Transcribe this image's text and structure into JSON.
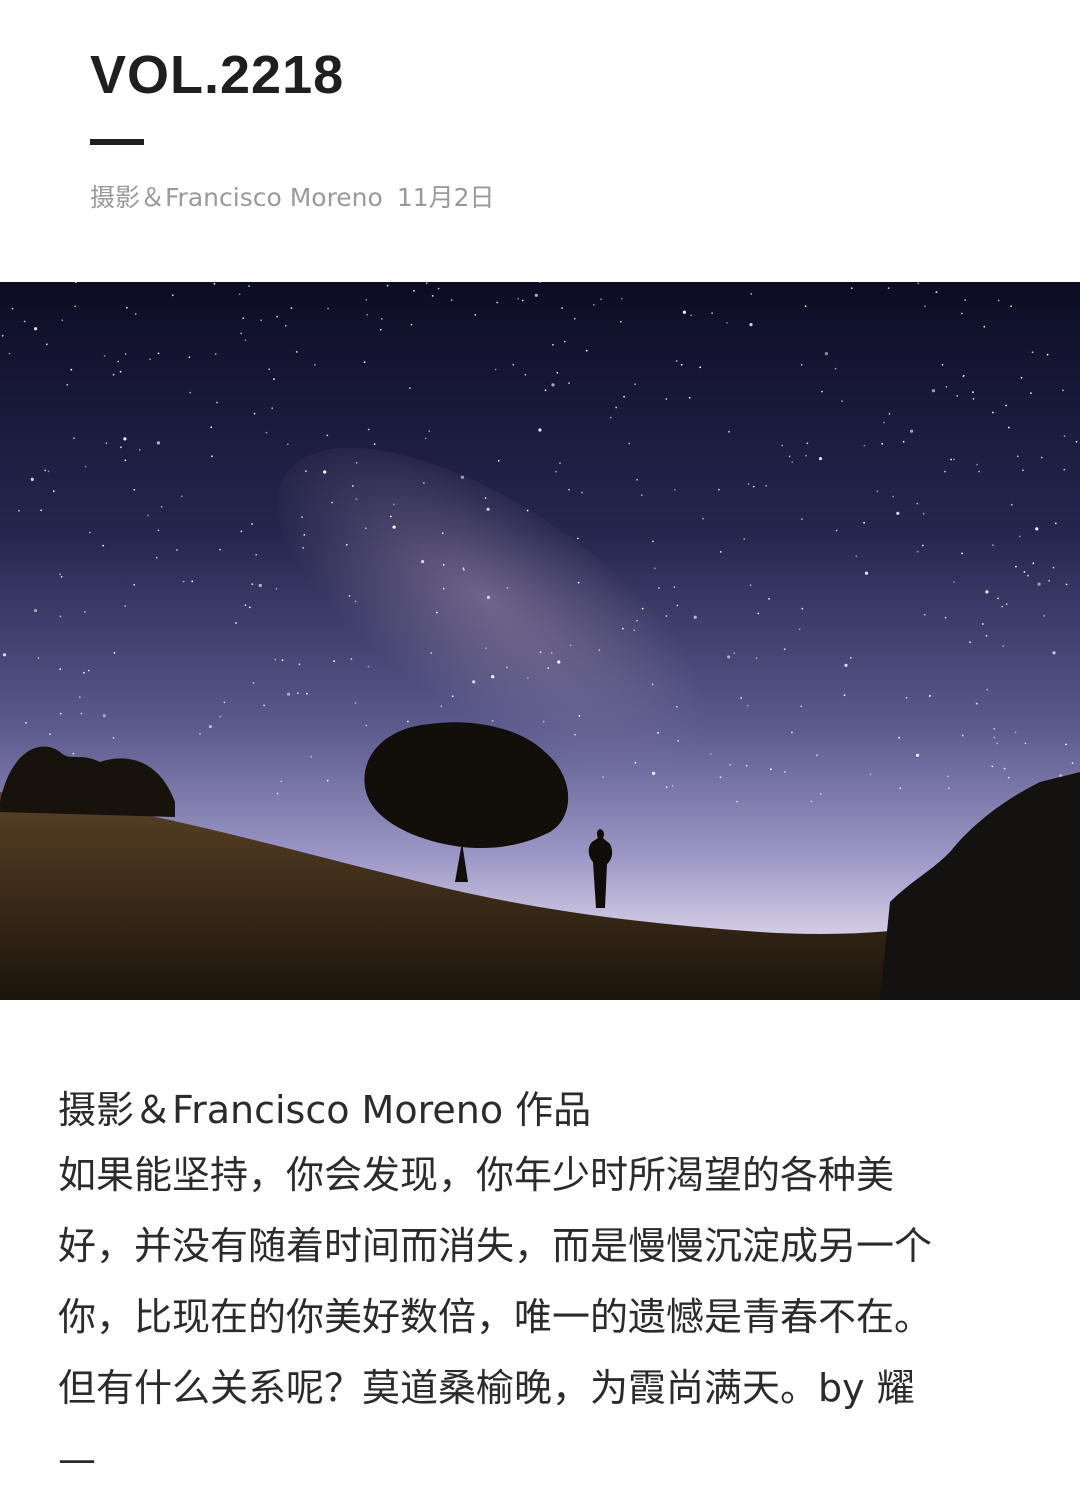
{
  "header": {
    "title": "VOL.2218",
    "author": "摄影＆Francisco Moreno",
    "date": "11月2日"
  },
  "photo": {
    "description_icon": "night-sky-photo"
  },
  "article": {
    "credit": "摄影＆Francisco Moreno 作品",
    "lines": [
      "如果能坚持，你会发现，你年少时所渴望的各种美",
      "好，并没有随着时间而消失，而是慢慢沉淀成另一个",
      "你，比现在的你美好数倍，唯一的遗憾是青春不在。",
      "但有什么关系呢？莫道桑榆晚，为霞尚满天。by 耀",
      "—"
    ]
  },
  "colors": {
    "text": "#2b2b2b",
    "meta": "#9a9a9a",
    "sky_top": "#0e0f2a",
    "sky_horizon": "#b7b4d6"
  }
}
